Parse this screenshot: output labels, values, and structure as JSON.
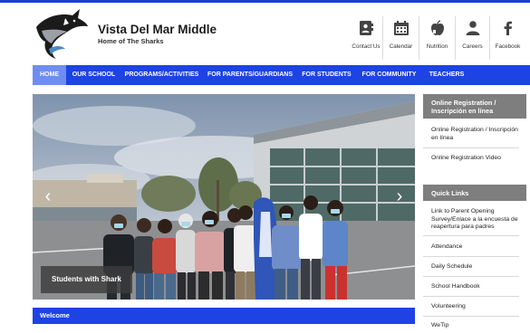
{
  "header": {
    "school_name": "Vista Del Mar Middle",
    "tagline": "Home of The Sharks"
  },
  "quick_icons": [
    {
      "label": "Contact Us",
      "icon": "contact-card-icon"
    },
    {
      "label": "Calendar",
      "icon": "calendar-icon"
    },
    {
      "label": "Nutrition",
      "icon": "apple-icon"
    },
    {
      "label": "Careers",
      "icon": "person-icon"
    },
    {
      "label": "Facebook",
      "icon": "facebook-icon"
    }
  ],
  "nav": {
    "items": [
      {
        "label": "HOME",
        "active": true
      },
      {
        "label": "OUR SCHOOL"
      },
      {
        "label": "PROGRAMS/ACTIVITIES"
      },
      {
        "label": "FOR PARENTS/GUARDIANS"
      },
      {
        "label": "FOR STUDENTS"
      },
      {
        "label": "FOR COMMUNITY"
      },
      {
        "label": "TEACHERS"
      }
    ]
  },
  "slideshow": {
    "caption": "Students with Shark",
    "prev": "‹",
    "next": "›"
  },
  "welcome": {
    "label": "Welcome"
  },
  "sidebar": {
    "registration": {
      "heading": "Online Registration / Inscripción en línea",
      "links": [
        "Online Registration / Inscripción en línea",
        "Online Registration Video"
      ]
    },
    "quick_links": {
      "heading": "Quick Links",
      "links": [
        "Link to Parent Opening Survey/Enlace a la encuesta de reapertura para padres",
        "Attendance",
        "Daily Schedule",
        "School Handbook",
        "Volunteering",
        "WeTip"
      ]
    }
  },
  "colors": {
    "nav_blue": "#1d43e2",
    "nav_active": "#6f8df0",
    "sidebar_header": "#7e7e7e"
  }
}
